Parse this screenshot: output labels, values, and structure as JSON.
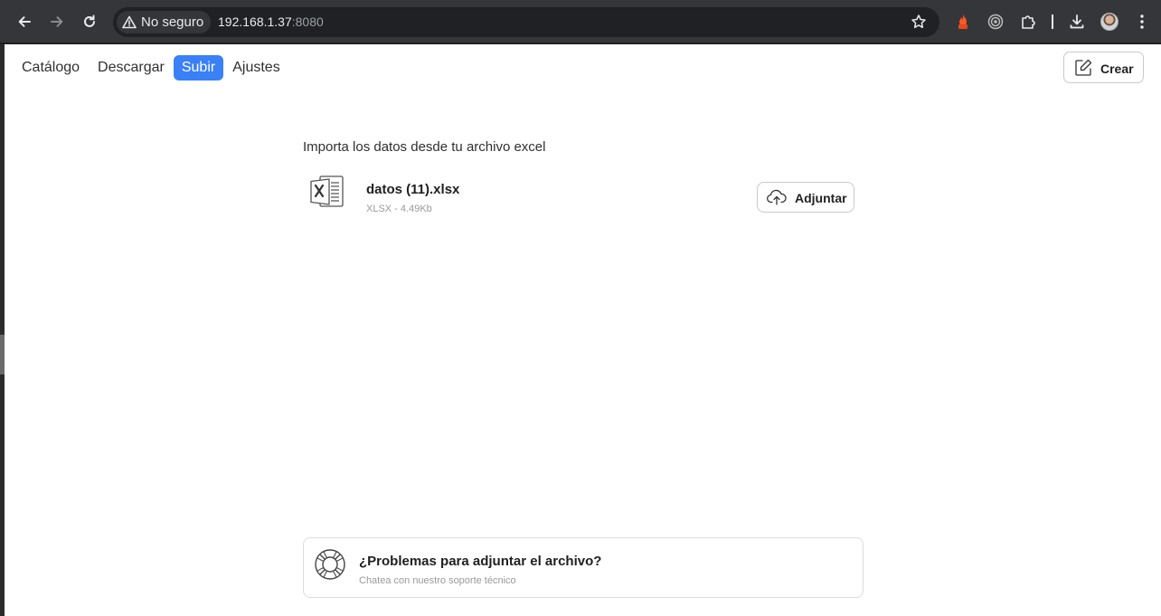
{
  "browser": {
    "security_label": "No seguro",
    "url_host": "192.168.1.37",
    "url_port": ":8080"
  },
  "nav": {
    "items": [
      {
        "label": "Catálogo"
      },
      {
        "label": "Descargar"
      },
      {
        "label": "Subir"
      },
      {
        "label": "Ajustes"
      }
    ],
    "active_index": 2,
    "create_label": "Crear"
  },
  "upload": {
    "title": "Importa los datos desde tu archivo excel",
    "file_name": "datos (11).xlsx",
    "file_meta": "XLSX - 4.49Kb",
    "attach_label": "Adjuntar"
  },
  "help": {
    "title": "¿Problemas para adjuntar el archivo?",
    "subtitle": "Chatea con nuestro soporte técnico"
  },
  "colors": {
    "accent": "#3a80f6",
    "chrome_bg": "#35363a"
  }
}
